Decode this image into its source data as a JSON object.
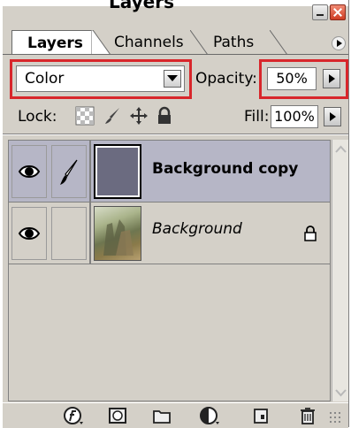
{
  "window": {
    "title_heading": "Layers"
  },
  "tabs": [
    {
      "label": "Layers",
      "active": true
    },
    {
      "label": "Channels",
      "active": false
    },
    {
      "label": "Paths",
      "active": false
    }
  ],
  "blend_mode": {
    "value": "Color"
  },
  "opacity": {
    "label": "Opacity:",
    "value": "50%"
  },
  "lock": {
    "label": "Lock:"
  },
  "fill": {
    "label": "Fill:",
    "value": "100%"
  },
  "layers": [
    {
      "name": "Background copy",
      "visible": true,
      "selected": true,
      "locked": false,
      "thumb_color": "#6b6b80"
    },
    {
      "name": "Background",
      "visible": true,
      "selected": false,
      "locked": true
    }
  ],
  "colors": {
    "highlight": "#d8262b",
    "panel_bg": "#d4d0c8",
    "selected_row": "#b6b6c6"
  }
}
